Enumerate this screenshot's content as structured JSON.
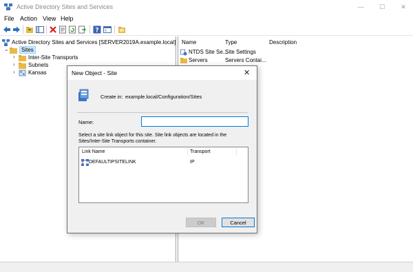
{
  "window": {
    "title": "Active Directory Sites and Services",
    "minimize_glyph": "—",
    "maximize_glyph": "☐",
    "close_glyph": "✕"
  },
  "menu": {
    "file": "File",
    "action": "Action",
    "view": "View",
    "help": "Help"
  },
  "toolbar": {
    "icons": [
      "back-arrow-icon",
      "forward-arrow-icon",
      "up-folder-icon",
      "show-tree-icon",
      "delete-icon",
      "properties-icon",
      "refresh-icon",
      "export-icon",
      "help-icon",
      "mmc-icon",
      "new-site-icon"
    ]
  },
  "tree": {
    "root": "Active Directory Sites and Services [SERVER2019A.example.local]",
    "sites": "Sites",
    "children": [
      "Inter-Site Transports",
      "Subnets",
      "Kansas"
    ]
  },
  "list": {
    "columns": [
      "Name",
      "Type",
      "Description"
    ],
    "rows": [
      {
        "name": "NTDS Site Se...",
        "type": "Site Settings"
      },
      {
        "name": "Servers",
        "type": "Servers Contai..."
      }
    ]
  },
  "dialog": {
    "title": "New Object - Site",
    "close_glyph": "✕",
    "create_in_label": "Create in:",
    "create_in_value": "example.local/Configuration/Sites",
    "name_label": "Name:",
    "name_value": "",
    "description": "Select a site link object for this site. Site link objects are located in the Sites/Inter-Site Transports container.",
    "link_columns": [
      "Link Name",
      "Transport"
    ],
    "links": [
      {
        "name": "DEFAULTIPSITELINK",
        "transport": "IP"
      }
    ],
    "ok": "OK",
    "cancel": "Cancel"
  },
  "colors": {
    "selection": "#cce8ff",
    "accent": "#0078d7",
    "dialog_bg": "#f0f0f0"
  }
}
